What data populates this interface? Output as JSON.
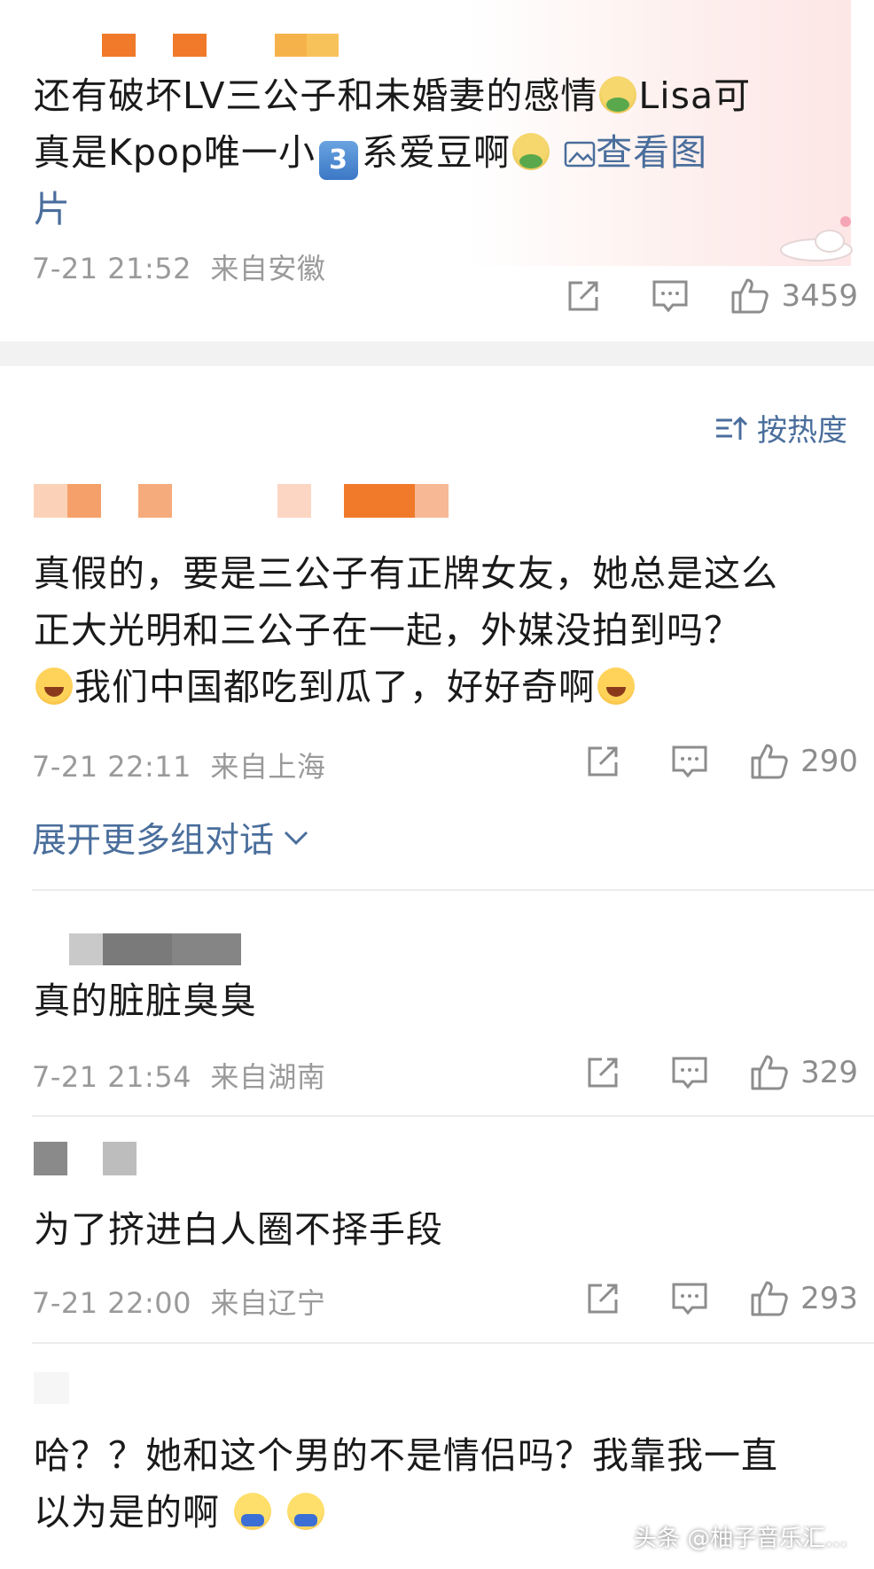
{
  "top_comment": {
    "text_line1": "还有破坏LV三公子和未婚妻的感情",
    "text_line1_tail": "Lisa可",
    "text_line2_a": "真是Kpop唯一小",
    "keycap": "3",
    "text_line2_b": "系爱豆啊",
    "view_image": "查看图",
    "view_image_tail": "片",
    "time": "7-21 21:52",
    "location": "来自安徽",
    "likes": "3459"
  },
  "sort_label": "按热度",
  "comments": [
    {
      "line1": "真假的，要是三公子有正牌女友，她总是这么",
      "line2": "正大光明和三公子在一起，外媒没拍到吗？",
      "line3": "我们中国都吃到瓜了，好好奇啊",
      "time": "7-21 22:11",
      "location": "来自上海",
      "likes": "290"
    },
    {
      "line1": "真的脏脏臭臭",
      "time": "7-21 21:54",
      "location": "来自湖南",
      "likes": "329"
    },
    {
      "line1": "为了挤进白人圈不择手段",
      "time": "7-21 22:00",
      "location": "来自辽宁",
      "likes": "293"
    },
    {
      "line1": "哈？？她和这个男的不是情侣吗？我靠我一直",
      "line2": "以为是的啊"
    }
  ],
  "expand_label": "展开更多组对话",
  "watermark": "头条 @柚子音乐汇...",
  "icons": {
    "share": "share-icon",
    "reply": "comment-icon",
    "like": "thumbs-up-icon",
    "sort": "sort-icon",
    "chevron": "chevron-down-icon",
    "image": "image-icon"
  },
  "colors": {
    "link": "#4a6e9c",
    "meta": "#9a9a9a",
    "separator": "#f2f2f2"
  }
}
